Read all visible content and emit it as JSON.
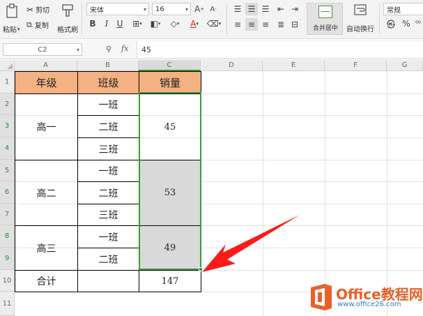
{
  "ribbon": {
    "paste": "粘贴",
    "cut": "剪切",
    "copy": "复制",
    "format_painter": "格式刷",
    "font_name": "宋体",
    "font_size": "16",
    "bold": "B",
    "italic": "I",
    "underline": "U",
    "merge_center": "合并居中",
    "wrap_text": "自动换行",
    "number_format": "常规",
    "percent": "%"
  },
  "formula_bar": {
    "cell_ref": "C2",
    "fx": "fx",
    "value": "45"
  },
  "columns": [
    "A",
    "B",
    "C",
    "D",
    "E",
    "F",
    "G"
  ],
  "rows": [
    "1",
    "2",
    "3",
    "4",
    "5",
    "6",
    "7",
    "8",
    "9",
    "10",
    "11"
  ],
  "table": {
    "headers": [
      "年级",
      "班级",
      "销量"
    ],
    "grades": [
      "高一",
      "高二",
      "高三"
    ],
    "classes": [
      "一班",
      "二班",
      "三班",
      "一班",
      "二班",
      "三班",
      "一班",
      "二班"
    ],
    "sales": [
      "45",
      "53",
      "49"
    ],
    "total_label": "合计",
    "total_value": "147"
  },
  "watermark": {
    "title": "Office教程网",
    "url": "www.office26.com"
  },
  "colors": {
    "header_fill": "#f4b183",
    "merged_fill": "#d9d9d9",
    "selection": "#3a9a3a",
    "arrow": "#ff1a1a",
    "logo_orange": "#e8602a"
  }
}
